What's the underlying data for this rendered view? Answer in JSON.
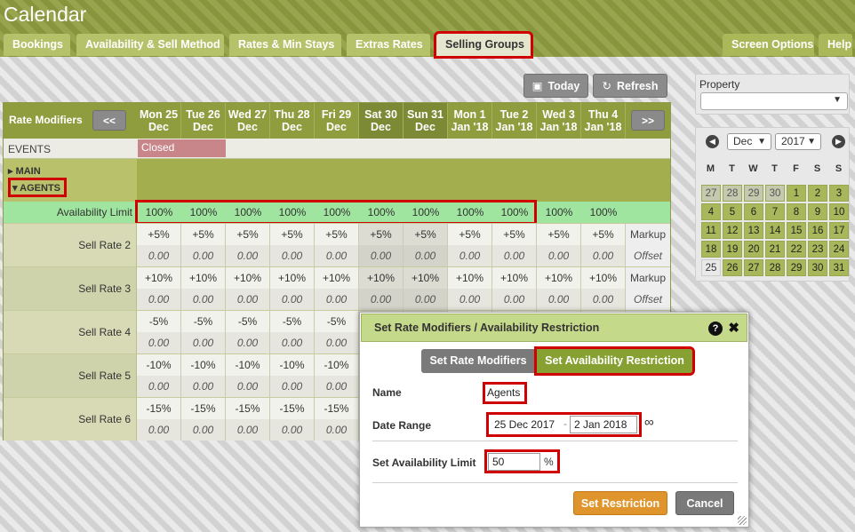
{
  "app": {
    "title": "Calendar"
  },
  "tabs": {
    "bookings": "Bookings",
    "availability": "Availability & Sell Method",
    "rates": "Rates & Min Stays",
    "extras": "Extras Rates",
    "selling_groups": "Selling Groups",
    "screen_options": "Screen Options",
    "help": "Help"
  },
  "toolbar": {
    "today": "Today",
    "refresh": "Refresh"
  },
  "grid": {
    "rate_modifiers_label": "Rate Modifiers",
    "prev": "<<",
    "next": ">>",
    "days": [
      {
        "day": "Mon 25",
        "month": "Dec"
      },
      {
        "day": "Tue 26",
        "month": "Dec"
      },
      {
        "day": "Wed 27",
        "month": "Dec"
      },
      {
        "day": "Thu 28",
        "month": "Dec"
      },
      {
        "day": "Fri 29",
        "month": "Dec"
      },
      {
        "day": "Sat 30",
        "month": "Dec"
      },
      {
        "day": "Sun 31",
        "month": "Dec"
      },
      {
        "day": "Mon 1",
        "month": "Jan '18"
      },
      {
        "day": "Tue 2",
        "month": "Jan '18"
      },
      {
        "day": "Wed 3",
        "month": "Jan '18"
      },
      {
        "day": "Thu 4",
        "month": "Jan '18"
      }
    ],
    "events_label": "EVENTS",
    "closed_label": "Closed",
    "group_main": "MAIN",
    "group_agents": "AGENTS",
    "availability_limit_label": "Availability Limit",
    "availability_values": [
      "100%",
      "100%",
      "100%",
      "100%",
      "100%",
      "100%",
      "100%",
      "100%",
      "100%",
      "100%",
      "100%"
    ],
    "rate_rows": [
      {
        "label": "Sell Rate 2",
        "top": "+5%",
        "bottom": "0.00",
        "meta_top": "Markup",
        "meta_bottom": "Offset"
      },
      {
        "label": "Sell Rate 3",
        "top": "+10%",
        "bottom": "0.00",
        "meta_top": "Markup",
        "meta_bottom": "Offset"
      },
      {
        "label": "Sell Rate 4",
        "top": "-5%",
        "bottom": "0.00",
        "meta_top": "",
        "meta_bottom": ""
      },
      {
        "label": "Sell Rate 5",
        "top": "-10%",
        "bottom": "0.00",
        "meta_top": "",
        "meta_bottom": ""
      },
      {
        "label": "Sell Rate 6",
        "top": "-15%",
        "bottom": "0.00",
        "meta_top": "",
        "meta_bottom": ""
      }
    ]
  },
  "sidebar": {
    "property_label": "Property",
    "property_value": "",
    "mini_calendar": {
      "month": "Dec",
      "year": "2017",
      "weekdays": [
        "M",
        "T",
        "W",
        "T",
        "F",
        "S",
        "S"
      ],
      "weeks": [
        [
          "27",
          "28",
          "29",
          "30",
          "1",
          "2",
          "3"
        ],
        [
          "4",
          "5",
          "6",
          "7",
          "8",
          "9",
          "10"
        ],
        [
          "11",
          "12",
          "13",
          "14",
          "15",
          "16",
          "17"
        ],
        [
          "18",
          "19",
          "20",
          "21",
          "22",
          "23",
          "24"
        ],
        [
          "25",
          "26",
          "27",
          "28",
          "29",
          "30",
          "31"
        ]
      ]
    }
  },
  "dialog": {
    "title": "Set Rate Modifiers / Availability Restriction",
    "help": "?",
    "close": "✖",
    "tab_rate_modifiers": "Set Rate Modifiers",
    "tab_availability": "Set Availability Restriction",
    "name_label": "Name",
    "name_value": "Agents",
    "date_range_label": "Date Range",
    "date_from": "25 Dec 2017",
    "date_sep": "-",
    "date_to": "2 Jan 2018",
    "infinity": "∞",
    "limit_label": "Set Availability Limit",
    "limit_value": "50",
    "limit_unit": "%",
    "set_button": "Set Restriction",
    "cancel_button": "Cancel"
  }
}
